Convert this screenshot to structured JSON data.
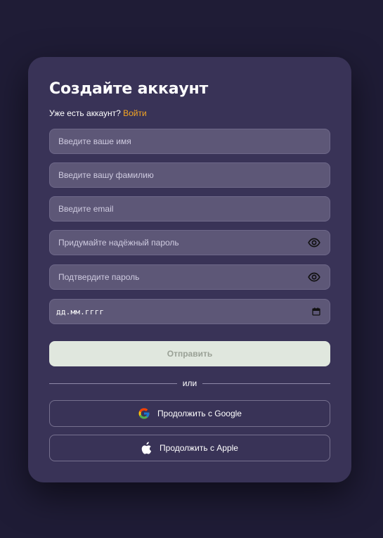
{
  "form": {
    "title": "Создайте аккаунт",
    "have_account_text": "Уже есть аккаунт? ",
    "login_link": "Войти",
    "fields": {
      "first_name_placeholder": "Введите ваше имя",
      "last_name_placeholder": "Введите вашу фамилию",
      "email_placeholder": "Введите email",
      "password_placeholder": "Придумайте надёжный пароль",
      "confirm_password_placeholder": "Подтвердите пароль",
      "date_placeholder": "дд.мм.гггг"
    },
    "submit_label": "Отправить",
    "divider_text": "или",
    "google_label": "Продолжить с Google",
    "apple_label": "Продолжить с Apple"
  },
  "icons": {
    "password_toggle": "eye-icon",
    "confirm_toggle": "eye-icon",
    "date_picker": "calendar-icon",
    "google": "google-icon",
    "apple": "apple-icon"
  },
  "colors": {
    "page_background": "#1f1c36",
    "card_background": "#393357",
    "input_background": "#5d5777",
    "accent_link": "#f5a623",
    "submit_background": "#e0e7de",
    "submit_text": "#9aa196"
  }
}
